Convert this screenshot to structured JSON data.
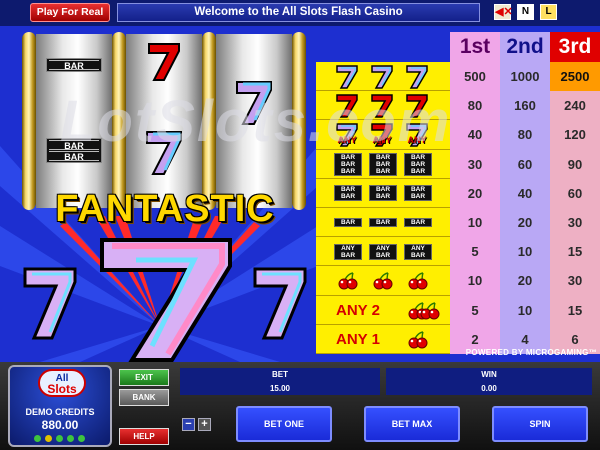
{
  "header": {
    "play_real_label": "Play For Real",
    "title": "Welcome to the All Slots Flash Casino",
    "sound_icon": "speaker-mute-icon",
    "n_label": "N",
    "l_label": "L"
  },
  "game": {
    "reel_bar_label": "BAR",
    "fantastic_text": "FANTASTIC",
    "watermark": "LotSlots.com"
  },
  "paytable": {
    "headers": [
      "1st",
      "2nd",
      "3rd"
    ],
    "rows": [
      {
        "symbol": "three-blue-sevens",
        "values": [
          "500",
          "1000",
          "2500"
        ]
      },
      {
        "symbol": "three-red-sevens",
        "values": [
          "80",
          "160",
          "240"
        ]
      },
      {
        "symbol": "any-three-sevens",
        "label": "ANY",
        "values": [
          "40",
          "80",
          "120"
        ]
      },
      {
        "symbol": "three-triple-bars",
        "label": "BAR",
        "values": [
          "30",
          "60",
          "90"
        ]
      },
      {
        "symbol": "three-double-bars",
        "label": "BAR",
        "values": [
          "20",
          "40",
          "60"
        ]
      },
      {
        "symbol": "three-single-bars",
        "label": "BAR",
        "values": [
          "10",
          "20",
          "30"
        ]
      },
      {
        "symbol": "any-three-bars",
        "label": "ANY BAR",
        "values": [
          "5",
          "10",
          "15"
        ]
      },
      {
        "symbol": "three-cherries",
        "values": [
          "10",
          "20",
          "30"
        ]
      },
      {
        "symbol": "any-two-cherries",
        "label": "ANY 2",
        "values": [
          "5",
          "10",
          "15"
        ]
      },
      {
        "symbol": "any-one-cherry",
        "label": "ANY 1",
        "values": [
          "2",
          "4",
          "6"
        ]
      }
    ],
    "powered_by": "POWERED BY MICROGAMING™"
  },
  "panel": {
    "logo_top": "All",
    "logo_bottom": "Slots",
    "demo_label": "DEMO CREDITS",
    "demo_value": "880.00",
    "exit_label": "EXIT",
    "bank_label": "BANK",
    "help_label": "HELP",
    "minus_label": "−",
    "plus_label": "+",
    "bet_label": "BET",
    "bet_value": "15.00",
    "win_label": "WIN",
    "win_value": "0.00",
    "bet_one_label": "BET ONE",
    "bet_max_label": "BET MAX",
    "spin_label": "SPIN"
  },
  "colors": {
    "background_blue": "#1d2fd0",
    "paytable_yellow": "#ffef00",
    "col1": "#f0a6e8",
    "col2": "#b9a8f5",
    "col3": "#eeb0c4",
    "button_blue": "#1a2bd8"
  }
}
